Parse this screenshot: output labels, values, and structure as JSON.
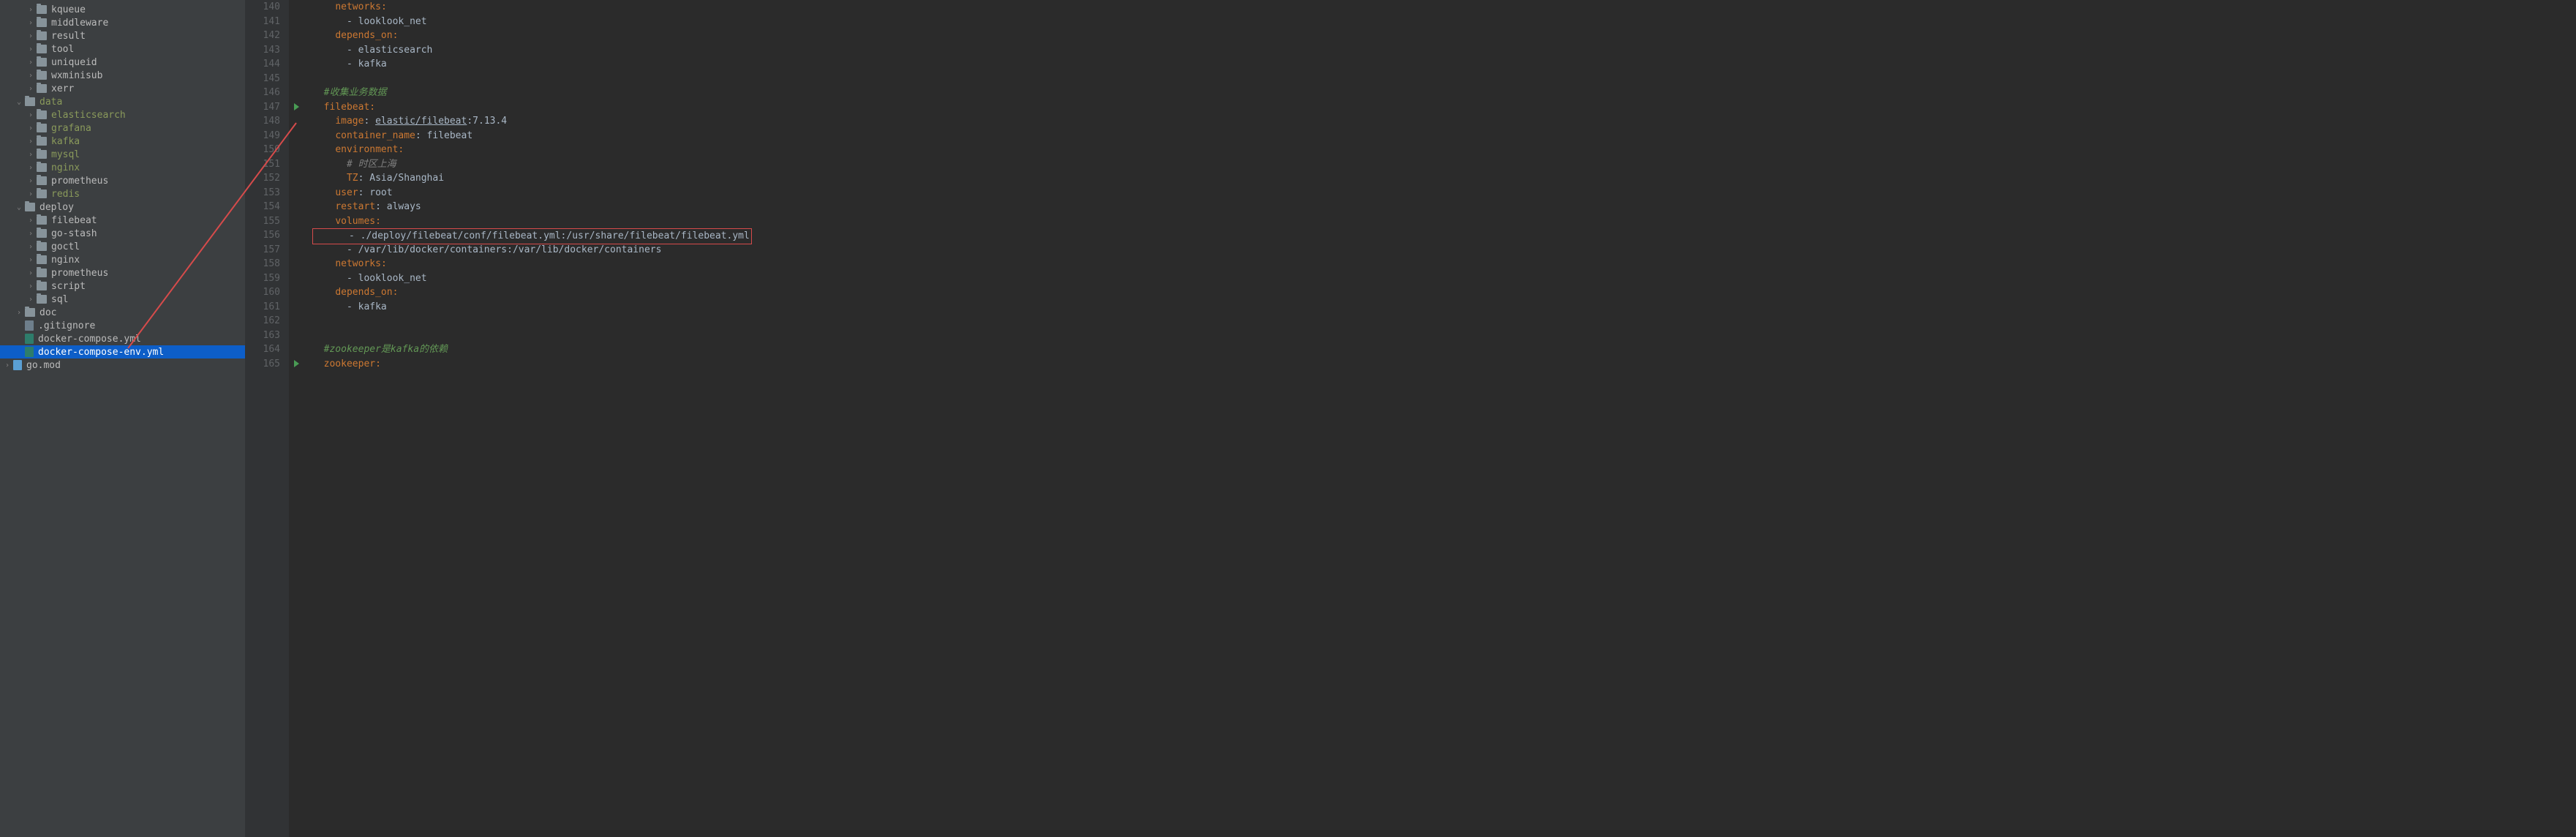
{
  "sidebar": {
    "items": [
      {
        "depth": 2,
        "arrow": "collapsed",
        "icon": "folder",
        "label": "kqueue",
        "modified": false
      },
      {
        "depth": 2,
        "arrow": "collapsed",
        "icon": "folder",
        "label": "middleware",
        "modified": false
      },
      {
        "depth": 2,
        "arrow": "collapsed",
        "icon": "folder",
        "label": "result",
        "modified": false
      },
      {
        "depth": 2,
        "arrow": "collapsed",
        "icon": "folder",
        "label": "tool",
        "modified": false
      },
      {
        "depth": 2,
        "arrow": "collapsed",
        "icon": "folder",
        "label": "uniqueid",
        "modified": false
      },
      {
        "depth": 2,
        "arrow": "collapsed",
        "icon": "folder",
        "label": "wxminisub",
        "modified": false
      },
      {
        "depth": 2,
        "arrow": "collapsed",
        "icon": "folder",
        "label": "xerr",
        "modified": false
      },
      {
        "depth": 1,
        "arrow": "expanded",
        "icon": "folder",
        "label": "data",
        "modified": true
      },
      {
        "depth": 2,
        "arrow": "collapsed",
        "icon": "folder",
        "label": "elasticsearch",
        "modified": true
      },
      {
        "depth": 2,
        "arrow": "collapsed",
        "icon": "folder",
        "label": "grafana",
        "modified": true
      },
      {
        "depth": 2,
        "arrow": "collapsed",
        "icon": "folder",
        "label": "kafka",
        "modified": true
      },
      {
        "depth": 2,
        "arrow": "collapsed",
        "icon": "folder",
        "label": "mysql",
        "modified": true
      },
      {
        "depth": 2,
        "arrow": "collapsed",
        "icon": "folder",
        "label": "nginx",
        "modified": true
      },
      {
        "depth": 2,
        "arrow": "collapsed",
        "icon": "folder",
        "label": "prometheus",
        "modified": false
      },
      {
        "depth": 2,
        "arrow": "collapsed",
        "icon": "folder",
        "label": "redis",
        "modified": true
      },
      {
        "depth": 1,
        "arrow": "expanded",
        "icon": "folder",
        "label": "deploy",
        "modified": false
      },
      {
        "depth": 2,
        "arrow": "collapsed",
        "icon": "folder",
        "label": "filebeat",
        "modified": false
      },
      {
        "depth": 2,
        "arrow": "collapsed",
        "icon": "folder",
        "label": "go-stash",
        "modified": false
      },
      {
        "depth": 2,
        "arrow": "collapsed",
        "icon": "folder",
        "label": "goctl",
        "modified": false
      },
      {
        "depth": 2,
        "arrow": "collapsed",
        "icon": "folder",
        "label": "nginx",
        "modified": false
      },
      {
        "depth": 2,
        "arrow": "collapsed",
        "icon": "folder",
        "label": "prometheus",
        "modified": false
      },
      {
        "depth": 2,
        "arrow": "collapsed",
        "icon": "folder",
        "label": "script",
        "modified": false
      },
      {
        "depth": 2,
        "arrow": "collapsed",
        "icon": "folder",
        "label": "sql",
        "modified": false
      },
      {
        "depth": 1,
        "arrow": "collapsed",
        "icon": "folder",
        "label": "doc",
        "modified": false
      },
      {
        "depth": 1,
        "arrow": "none",
        "icon": "file",
        "label": ".gitignore",
        "modified": false
      },
      {
        "depth": 1,
        "arrow": "none",
        "icon": "yml",
        "label": "docker-compose.yml",
        "modified": false
      },
      {
        "depth": 1,
        "arrow": "none",
        "icon": "yml",
        "label": "docker-compose-env.yml",
        "modified": false,
        "selected": true
      },
      {
        "depth": 0,
        "arrow": "collapsed",
        "icon": "go",
        "label": "go.mod",
        "modified": false
      }
    ]
  },
  "editor": {
    "startLine": 140,
    "lines": [
      {
        "n": 140,
        "segments": [
          {
            "t": "    ",
            "c": ""
          },
          {
            "t": "networks",
            "c": "tok-key"
          },
          {
            "t": ":",
            "c": "tok-key"
          }
        ]
      },
      {
        "n": 141,
        "segments": [
          {
            "t": "      - ",
            "c": ""
          },
          {
            "t": "looklook_net",
            "c": "tok-val"
          }
        ]
      },
      {
        "n": 142,
        "segments": [
          {
            "t": "    ",
            "c": ""
          },
          {
            "t": "depends_on",
            "c": "tok-key"
          },
          {
            "t": ":",
            "c": "tok-key"
          }
        ]
      },
      {
        "n": 143,
        "segments": [
          {
            "t": "      - ",
            "c": ""
          },
          {
            "t": "elasticsearch",
            "c": "tok-val"
          }
        ]
      },
      {
        "n": 144,
        "segments": [
          {
            "t": "      - ",
            "c": ""
          },
          {
            "t": "kafka",
            "c": "tok-val"
          }
        ]
      },
      {
        "n": 145,
        "segments": [
          {
            "t": "",
            "c": ""
          }
        ]
      },
      {
        "n": 146,
        "segments": [
          {
            "t": "  ",
            "c": ""
          },
          {
            "t": "#收集业务数据",
            "c": "tok-comment-green"
          }
        ]
      },
      {
        "n": 147,
        "marker": "play",
        "segments": [
          {
            "t": "  ",
            "c": ""
          },
          {
            "t": "filebeat",
            "c": "tok-key"
          },
          {
            "t": ":",
            "c": "tok-key"
          }
        ]
      },
      {
        "n": 148,
        "segments": [
          {
            "t": "    ",
            "c": ""
          },
          {
            "t": "image",
            "c": "tok-key"
          },
          {
            "t": ": ",
            "c": ""
          },
          {
            "t": "elastic/filebeat",
            "c": "tok-underline"
          },
          {
            "t": ":7.13.4",
            "c": "tok-val"
          }
        ]
      },
      {
        "n": 149,
        "segments": [
          {
            "t": "    ",
            "c": ""
          },
          {
            "t": "container_name",
            "c": "tok-key"
          },
          {
            "t": ": ",
            "c": ""
          },
          {
            "t": "filebeat",
            "c": "tok-val"
          }
        ]
      },
      {
        "n": 150,
        "segments": [
          {
            "t": "    ",
            "c": ""
          },
          {
            "t": "environment",
            "c": "tok-key"
          },
          {
            "t": ":",
            "c": "tok-key"
          }
        ]
      },
      {
        "n": 151,
        "segments": [
          {
            "t": "      ",
            "c": ""
          },
          {
            "t": "# 时区上海",
            "c": "tok-comment"
          }
        ]
      },
      {
        "n": 152,
        "segments": [
          {
            "t": "      ",
            "c": ""
          },
          {
            "t": "TZ",
            "c": "tok-key"
          },
          {
            "t": ": ",
            "c": ""
          },
          {
            "t": "Asia/Shanghai",
            "c": "tok-val"
          }
        ]
      },
      {
        "n": 153,
        "segments": [
          {
            "t": "    ",
            "c": ""
          },
          {
            "t": "user",
            "c": "tok-key"
          },
          {
            "t": ": ",
            "c": ""
          },
          {
            "t": "root",
            "c": "tok-val"
          }
        ]
      },
      {
        "n": 154,
        "segments": [
          {
            "t": "    ",
            "c": ""
          },
          {
            "t": "restart",
            "c": "tok-key"
          },
          {
            "t": ": ",
            "c": ""
          },
          {
            "t": "always",
            "c": "tok-val"
          }
        ]
      },
      {
        "n": 155,
        "segments": [
          {
            "t": "    ",
            "c": ""
          },
          {
            "t": "volumes",
            "c": "tok-key"
          },
          {
            "t": ":",
            "c": "tok-key"
          }
        ]
      },
      {
        "n": 156,
        "highlight": true,
        "segments": [
          {
            "t": "      - ",
            "c": ""
          },
          {
            "t": "./deploy/filebeat/conf/filebeat.yml:/usr/share/filebeat/filebeat.yml",
            "c": "tok-val"
          }
        ]
      },
      {
        "n": 157,
        "segments": [
          {
            "t": "      - ",
            "c": ""
          },
          {
            "t": "/var/lib/docker/containers:/var/lib/docker/containers",
            "c": "tok-val"
          }
        ]
      },
      {
        "n": 158,
        "segments": [
          {
            "t": "    ",
            "c": ""
          },
          {
            "t": "networks",
            "c": "tok-key"
          },
          {
            "t": ":",
            "c": "tok-key"
          }
        ]
      },
      {
        "n": 159,
        "segments": [
          {
            "t": "      - ",
            "c": ""
          },
          {
            "t": "looklook_net",
            "c": "tok-val"
          }
        ]
      },
      {
        "n": 160,
        "segments": [
          {
            "t": "    ",
            "c": ""
          },
          {
            "t": "depends_on",
            "c": "tok-key"
          },
          {
            "t": ":",
            "c": "tok-key"
          }
        ]
      },
      {
        "n": 161,
        "segments": [
          {
            "t": "      - ",
            "c": ""
          },
          {
            "t": "kafka",
            "c": "tok-val"
          }
        ]
      },
      {
        "n": 162,
        "segments": [
          {
            "t": "",
            "c": ""
          }
        ]
      },
      {
        "n": 163,
        "segments": [
          {
            "t": "",
            "c": ""
          }
        ]
      },
      {
        "n": 164,
        "segments": [
          {
            "t": "  ",
            "c": ""
          },
          {
            "t": "#zookeeper是kafka的依赖",
            "c": "tok-comment-green"
          }
        ]
      },
      {
        "n": 165,
        "marker": "play",
        "segments": [
          {
            "t": "  ",
            "c": ""
          },
          {
            "t": "zookeeper",
            "c": "tok-key"
          },
          {
            "t": ":",
            "c": "tok-key"
          }
        ]
      }
    ]
  }
}
